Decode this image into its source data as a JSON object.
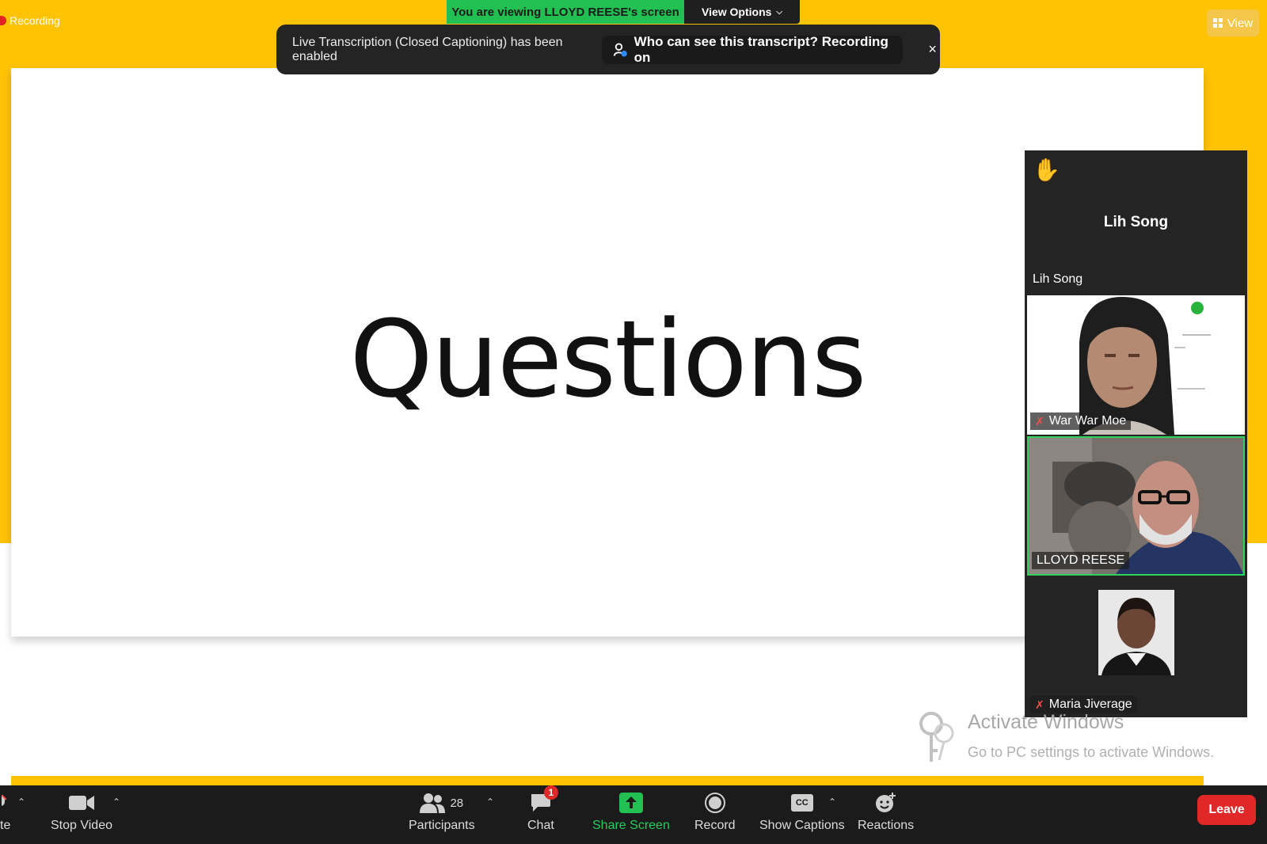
{
  "recording": {
    "label": "Recording"
  },
  "banner": {
    "viewing": "You are viewing LLOYD REESE's screen",
    "view_options": "View Options"
  },
  "view_button": {
    "label": "View"
  },
  "notification": {
    "message": "Live Transcription (Closed Captioning) has been enabled",
    "pill": "Who can see this transcript? Recording on",
    "close": "×"
  },
  "slide": {
    "title": "Questions"
  },
  "gallery": {
    "tiles": [
      {
        "center_name": "Lih Song",
        "label": "Lih Song"
      },
      {
        "label": "War War Moe",
        "muted": true
      },
      {
        "label": "LLOYD REESE",
        "muted": false,
        "active_speaker": true
      },
      {
        "label": "Maria Jiverage",
        "muted": true
      }
    ]
  },
  "toolbar": {
    "mute_partial": "te",
    "stop_video": "Stop Video",
    "participants": "Participants",
    "participants_count": "28",
    "chat": "Chat",
    "chat_badge": "1",
    "share_screen": "Share Screen",
    "record": "Record",
    "show_captions": "Show Captions",
    "cc_glyph": "CC",
    "reactions": "Reactions",
    "leave": "Leave"
  },
  "watermark": {
    "title": "Activate Windows",
    "subtitle": "Go to PC settings to activate Windows."
  },
  "colors": {
    "zoom_yellow": "#fec305",
    "banner_green": "#22bf53",
    "leave_red": "#e02828",
    "toolbar_bg": "#1b1b1b",
    "share_green": "#22bf53"
  }
}
